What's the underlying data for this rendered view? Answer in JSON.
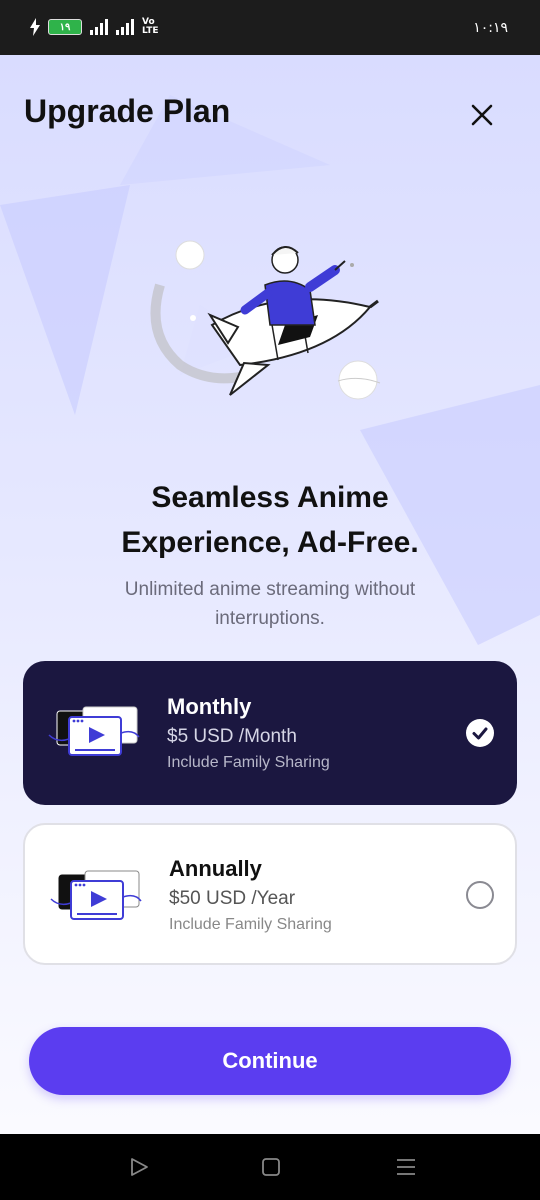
{
  "status_bar": {
    "battery": "١٩",
    "network": "Vo LTE",
    "network_line1": "Vo",
    "network_line2": "LTE",
    "time": "١٠:١٩"
  },
  "header": {
    "title": "Upgrade Plan",
    "close_icon": "close-icon"
  },
  "hero": {
    "headline_line1": "Seamless Anime",
    "headline_line2": "Experience, Ad-Free.",
    "subtitle_line1": "Unlimited anime streaming without",
    "subtitle_line2": "interruptions."
  },
  "plans": [
    {
      "name": "Monthly",
      "price": "$5 USD /Month",
      "note": "Include Family Sharing",
      "selected": true,
      "icon": "video-player-icon"
    },
    {
      "name": "Annually",
      "price": "$50 USD /Year",
      "note": "Include Family Sharing",
      "selected": false,
      "icon": "video-player-icon"
    }
  ],
  "continue_label": "Continue",
  "nav": {
    "back_icon": "back-triangle-icon",
    "home_icon": "home-square-icon",
    "menu_icon": "menu-lines-icon"
  },
  "colors": {
    "accent": "#5b3df0",
    "selected_card": "#1b1740",
    "background_top": "#d9dcff"
  }
}
